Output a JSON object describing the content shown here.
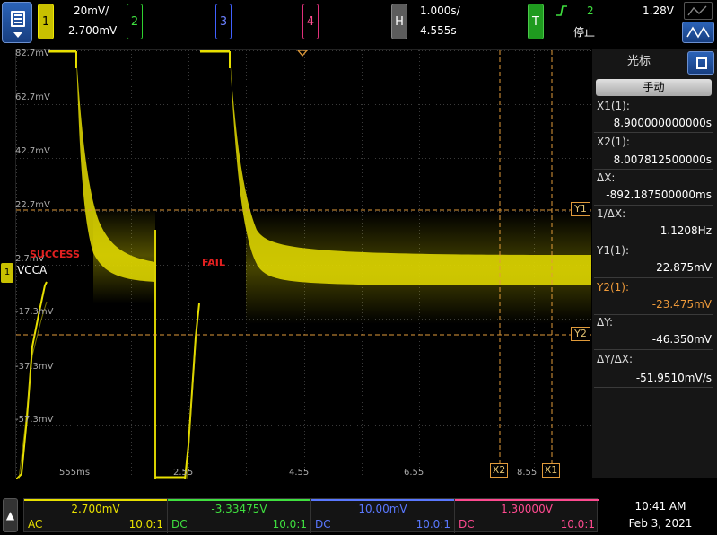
{
  "topbar": {
    "ch1": {
      "label": "1",
      "scale": "20mV/",
      "offset": "2.700mV"
    },
    "ch2": {
      "label": "2"
    },
    "ch3": {
      "label": "3"
    },
    "ch4": {
      "label": "4"
    },
    "horizontal": {
      "label": "H",
      "scale": "1.000s/",
      "position": "4.555s"
    },
    "trigger": {
      "label": "T",
      "source": "2",
      "level": "1.28V",
      "state": "停止",
      "edge_icon": "rising-edge-icon"
    }
  },
  "screen": {
    "y_ticks": [
      "82.7mV",
      "62.7mV",
      "42.7mV",
      "22.7mV",
      "2.7mV",
      "-17.3mV",
      "-37.3mV",
      "-57.3mV"
    ],
    "x_ticks": [
      "555ms",
      "2.55",
      "4.55",
      "6.55",
      "8.55"
    ],
    "annotations": {
      "success": "SUCCESS",
      "fail": "FAIL"
    },
    "channel_label": "VCCA",
    "ground_marker": "1",
    "cursor_tags": {
      "y1": "Y1",
      "y2": "Y2",
      "x1": "X1",
      "x2": "X2"
    },
    "colors": {
      "trace": "#e8e000",
      "cursor": "#e09a3a",
      "grid": "#3a3a3a"
    }
  },
  "panel": {
    "title": "光标",
    "mode": "手动",
    "x1_label": "X1(1):",
    "x1_value": "8.900000000000s",
    "x2_label": "X2(1):",
    "x2_value": "8.007812500000s",
    "dx_label": "ΔX:",
    "dx_value": "-892.187500000ms",
    "inv_dx_label": "1/ΔX:",
    "inv_dx_value": "1.1208Hz",
    "y1_label": "Y1(1):",
    "y1_value": "22.875mV",
    "y2_label": "Y2(1):",
    "y2_value": "-23.475mV",
    "dy_label": "ΔY:",
    "dy_value": "-46.350mV",
    "dydx_label": "ΔY/ΔX:",
    "dydx_value": "-51.9510mV/s"
  },
  "bottom": {
    "channels": [
      {
        "value": "2.700mV",
        "coupling": "AC",
        "probe": "10.0:1",
        "color": "#e8e000"
      },
      {
        "value": "-3.33475V",
        "coupling": "DC",
        "probe": "10.0:1",
        "color": "#3fe03f"
      },
      {
        "value": "10.00mV",
        "coupling": "DC",
        "probe": "10.0:1",
        "color": "#5a78ff"
      },
      {
        "value": "1.30000V",
        "coupling": "DC",
        "probe": "10.0:1",
        "color": "#ff4a90"
      }
    ],
    "time": "10:41 AM",
    "date": "Feb 3, 2021"
  }
}
